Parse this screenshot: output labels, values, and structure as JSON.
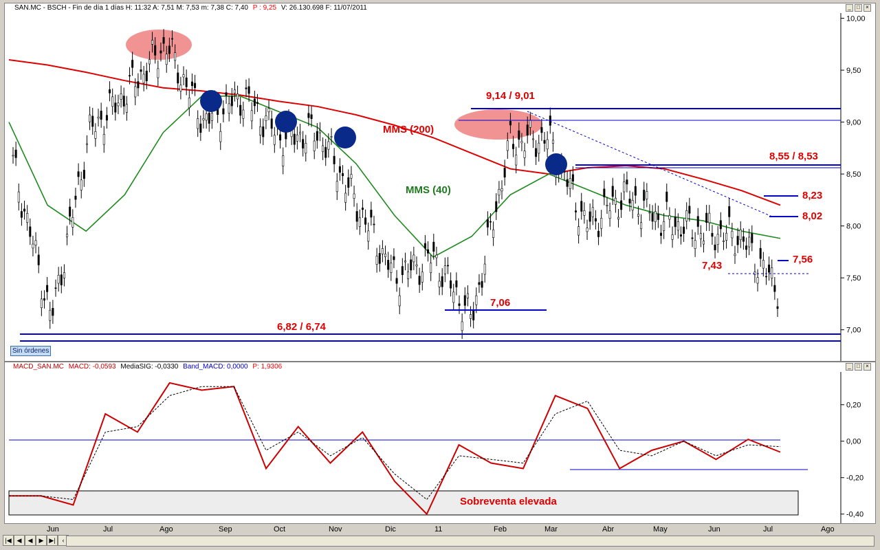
{
  "header": {
    "ticker_line": "SAN.MC - BSCH - Fin de día 1 días  H: 11:32  A: 7,51  M: 7,53  m: 7,38  C: 7,40",
    "p_label": "P : 9,25",
    "rest": "V: 26.130.698  F: 11/07/2011"
  },
  "macd_header": {
    "name": "MACD_SAN.MC",
    "macd": "MACD: -0,0593",
    "signal": "MediaSIG: -0,0330",
    "band": "Band_MACD: 0,0000",
    "p": "P: 1,9306"
  },
  "badge": "Sin órdenes",
  "annotations": {
    "mms200": "MMS (200)",
    "mms40": "MMS (40)",
    "r914": "9,14 / 9,01",
    "r855": "8,55 / 8,53",
    "r823": "8,23",
    "r802": "8,02",
    "r756": "7,56",
    "r743": "7,43",
    "r706": "7,06",
    "r682": "6,82 / 6,74",
    "oversold": "Sobreventa elevada"
  },
  "x_labels": [
    "Jun",
    "Jul",
    "Ago",
    "Sep",
    "Oct",
    "Nov",
    "Dic",
    "11",
    "Feb",
    "Mar",
    "Abr",
    "May",
    "Jun",
    "Jul",
    "Ago"
  ],
  "chart_data": [
    {
      "type": "line",
      "title": "SAN.MC - BSCH",
      "ylim": [
        6.7,
        10.05
      ],
      "y_ticks": [
        "10,00",
        "9,50",
        "9,00",
        "8,50",
        "8,00",
        "7,50",
        "7,00"
      ],
      "y_tick_values": [
        10.0,
        9.5,
        9.0,
        8.5,
        8.0,
        7.5,
        7.0
      ],
      "series": [
        {
          "name": "MMS (200)",
          "color": "#dd0000",
          "values": [
            9.6,
            9.55,
            9.48,
            9.4,
            9.33,
            9.3,
            9.26,
            9.2,
            9.15,
            9.07,
            8.97,
            8.85,
            8.7,
            8.55,
            8.5,
            8.56,
            8.58,
            8.55,
            8.45,
            8.34,
            8.2
          ]
        },
        {
          "name": "MMS (40)",
          "color": "#1e8a1e",
          "values": [
            9.0,
            8.2,
            7.95,
            8.3,
            8.9,
            9.25,
            9.25,
            9.1,
            8.95,
            8.6,
            8.1,
            7.7,
            7.9,
            8.3,
            8.5,
            8.35,
            8.2,
            8.1,
            8.05,
            7.95,
            7.88
          ]
        },
        {
          "name": "price",
          "color": "#000000",
          "values": [
            8.6,
            7.1,
            8.9,
            9.3,
            9.75,
            9.0,
            9.25,
            8.85,
            8.9,
            8.2,
            7.5,
            7.7,
            7.1,
            8.8,
            8.85,
            8.0,
            8.3,
            8.05,
            7.95,
            7.9,
            7.4
          ]
        }
      ],
      "levels": [
        9.14,
        9.01,
        8.55,
        8.53,
        8.23,
        8.02,
        7.56,
        7.43,
        7.06,
        6.82,
        6.74
      ]
    },
    {
      "type": "line",
      "title": "MACD_SAN.MC",
      "ylim": [
        -0.45,
        0.38
      ],
      "y_ticks": [
        "0,20",
        "0,00",
        "-0,20",
        "-0,40"
      ],
      "y_tick_values": [
        0.2,
        0.0,
        -0.2,
        -0.4
      ],
      "series": [
        {
          "name": "MACD",
          "color": "#cc0000",
          "values": [
            -0.3,
            -0.3,
            -0.35,
            0.15,
            0.05,
            0.32,
            0.28,
            0.3,
            -0.15,
            0.08,
            -0.12,
            0.05,
            -0.22,
            -0.4,
            -0.02,
            -0.12,
            -0.15,
            0.25,
            0.18,
            -0.15,
            -0.05,
            0.0,
            -0.1,
            0.01,
            -0.06
          ]
        },
        {
          "name": "MediaSIG",
          "color": "#000000",
          "values": [
            -0.3,
            -0.3,
            -0.32,
            0.05,
            0.08,
            0.25,
            0.3,
            0.3,
            -0.05,
            0.05,
            -0.08,
            0.02,
            -0.18,
            -0.32,
            -0.08,
            -0.1,
            -0.12,
            0.15,
            0.22,
            -0.05,
            -0.08,
            0.0,
            -0.08,
            -0.02,
            -0.03
          ]
        }
      ]
    }
  ]
}
